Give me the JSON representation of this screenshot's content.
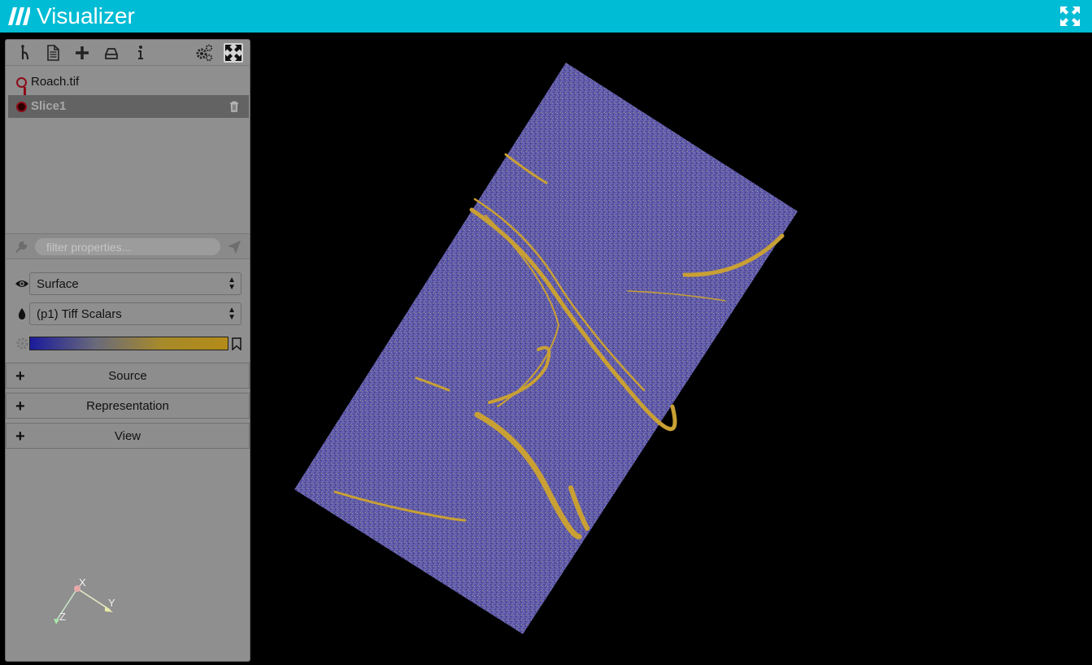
{
  "app": {
    "title": "Visualizer"
  },
  "toolbar": {
    "buttons": [
      "pipeline-icon",
      "document-icon",
      "add-icon",
      "storage-icon",
      "info-icon",
      "settings-icon",
      "collapse-icon"
    ]
  },
  "pipeline": {
    "items": [
      {
        "label": "Roach.tif",
        "selected": false
      },
      {
        "label": "Slice1",
        "selected": true
      }
    ]
  },
  "filter": {
    "placeholder": "filter properties..."
  },
  "properties": {
    "representation": "Surface",
    "color_by": "(p1) Tiff Scalars",
    "colormap": {
      "start": "#1b1b9c",
      "end": "#b38b18"
    }
  },
  "sections": [
    {
      "label": "Source"
    },
    {
      "label": "Representation"
    },
    {
      "label": "View"
    }
  ],
  "orientation_axes": {
    "x": "X",
    "y": "Y",
    "z": "Z"
  },
  "colors": {
    "header": "#00bcd4",
    "panel": "#8f8f8f",
    "accent": "#8c0b17",
    "slice_base": "#5a55a8",
    "slice_feature": "#c9a033"
  }
}
